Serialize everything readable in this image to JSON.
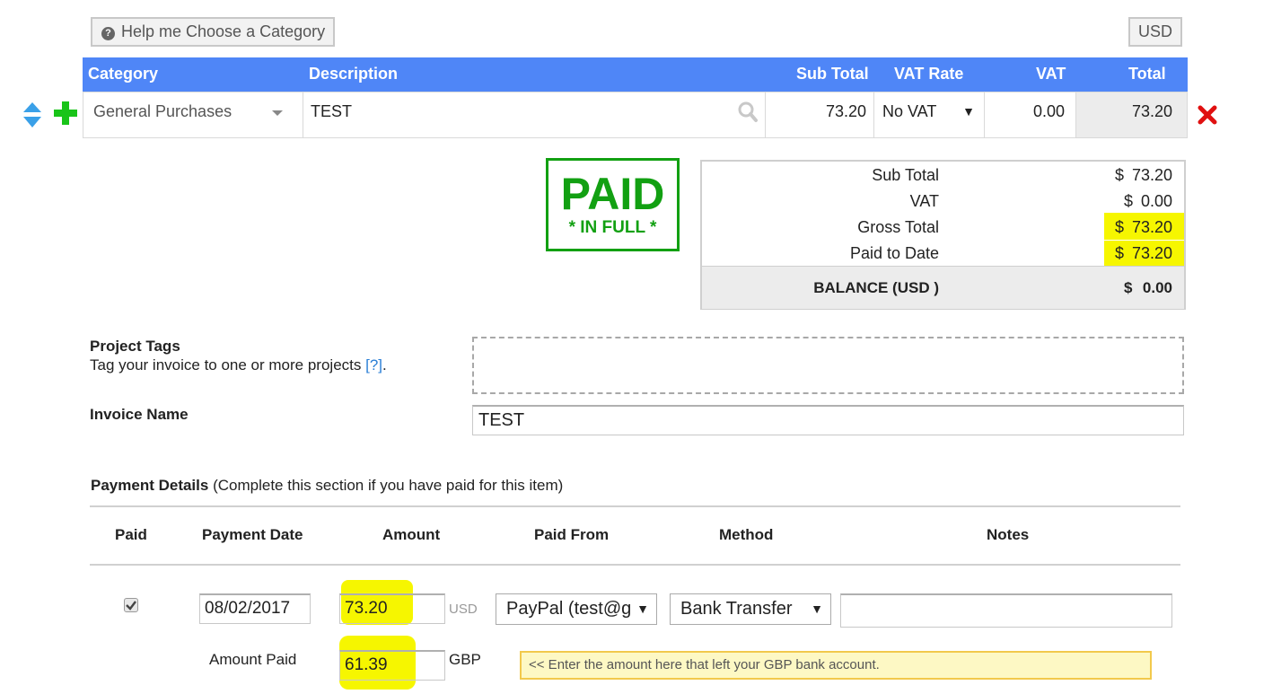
{
  "toolbar": {
    "help_label": "Help me Choose a Category",
    "currency_button": "USD"
  },
  "table": {
    "headers": {
      "category": "Category",
      "description": "Description",
      "sub_total": "Sub Total",
      "vat_rate": "VAT Rate",
      "vat": "VAT",
      "total": "Total"
    },
    "row": {
      "category": "General Purchases",
      "description": "TEST",
      "sub_total": "73.20",
      "vat_rate": "No VAT",
      "vat": "0.00",
      "total": "73.20"
    }
  },
  "stamp": {
    "big": "PAID",
    "small": "* IN FULL *"
  },
  "totals": {
    "currency": "$",
    "rows": [
      {
        "label": "Sub Total",
        "value": "73.20"
      },
      {
        "label": "VAT",
        "value": "0.00"
      },
      {
        "label": "Gross Total",
        "value": "73.20"
      },
      {
        "label": "Paid to Date",
        "value": "73.20"
      }
    ],
    "balance_label": "BALANCE (USD )",
    "balance_value": "0.00"
  },
  "project_tags": {
    "title": "Project Tags",
    "description": "Tag your invoice to one or more projects",
    "help_link": "[?]",
    "period": "."
  },
  "invoice_name": {
    "label": "Invoice Name",
    "value": "TEST"
  },
  "payment": {
    "title": "Payment Details",
    "subtitle": "(Complete this section if you have paid for this item)",
    "headers": {
      "paid": "Paid",
      "date": "Payment Date",
      "amount": "Amount",
      "paid_from": "Paid From",
      "method": "Method",
      "notes": "Notes"
    },
    "row": {
      "date": "08/02/2017",
      "amount": "73.20",
      "amount_currency": "USD",
      "paid_from": "PayPal (test@g",
      "method": "Bank Transfer",
      "notes": ""
    },
    "amount_paid_label": "Amount Paid",
    "amount_paid_value": "61.39",
    "amount_paid_currency": "GBP",
    "hint": "<< Enter the amount here that left your GBP bank account."
  },
  "colors": {
    "header_blue": "#4f86f7",
    "paid_green": "#12a012",
    "highlight": "#f6f600",
    "delete_red": "#e01010",
    "add_green": "#19c419"
  }
}
